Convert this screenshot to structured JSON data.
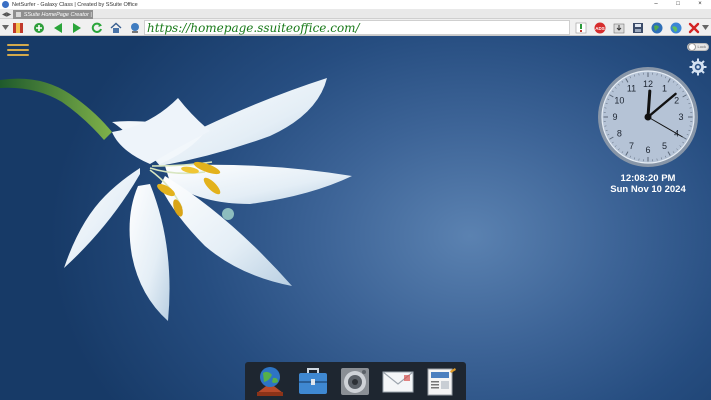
{
  "window": {
    "title": "NetSurfer - Galaxy Class | Created by SSuite Office",
    "controls": [
      "–",
      "□",
      "×"
    ]
  },
  "tab": {
    "label": "SSuite HomePage Creator | C",
    "nav": "◀▶"
  },
  "address_bar": {
    "url": "https://homepage.ssuiteoffice.com/"
  },
  "toolbar": {
    "adblock_label": "ADS",
    "icons": [
      "menu-dropdown-icon",
      "bookmark-book-icon",
      "new-tab-plus-icon",
      "back-arrow-icon",
      "forward-arrow-icon",
      "refresh-icon",
      "home-icon",
      "globe-search-icon",
      "info-icon",
      "adblock-icon",
      "download-icon",
      "save-icon",
      "world-icon",
      "world-icon",
      "close-icon"
    ]
  },
  "desktop": {
    "toggle_label": "Lock",
    "clock": {
      "numbers": [
        "12",
        "1",
        "2",
        "3",
        "4",
        "5",
        "6",
        "7",
        "8",
        "9",
        "10",
        "11"
      ],
      "hour": 12,
      "minute": 8,
      "second": 20
    },
    "time": "12:08:20 PM",
    "date": "Sun Nov 10 2024"
  },
  "dock": {
    "items": [
      "globe-app-icon",
      "briefcase-icon",
      "speaker-icon",
      "mail-envelope-icon",
      "newspaper-icon"
    ]
  },
  "colors": {
    "url_text": "#1a7a1a",
    "desktop_bg": "#2a5186",
    "hamburger": "#d4aa4c",
    "dock_bg": "#1e2630"
  }
}
